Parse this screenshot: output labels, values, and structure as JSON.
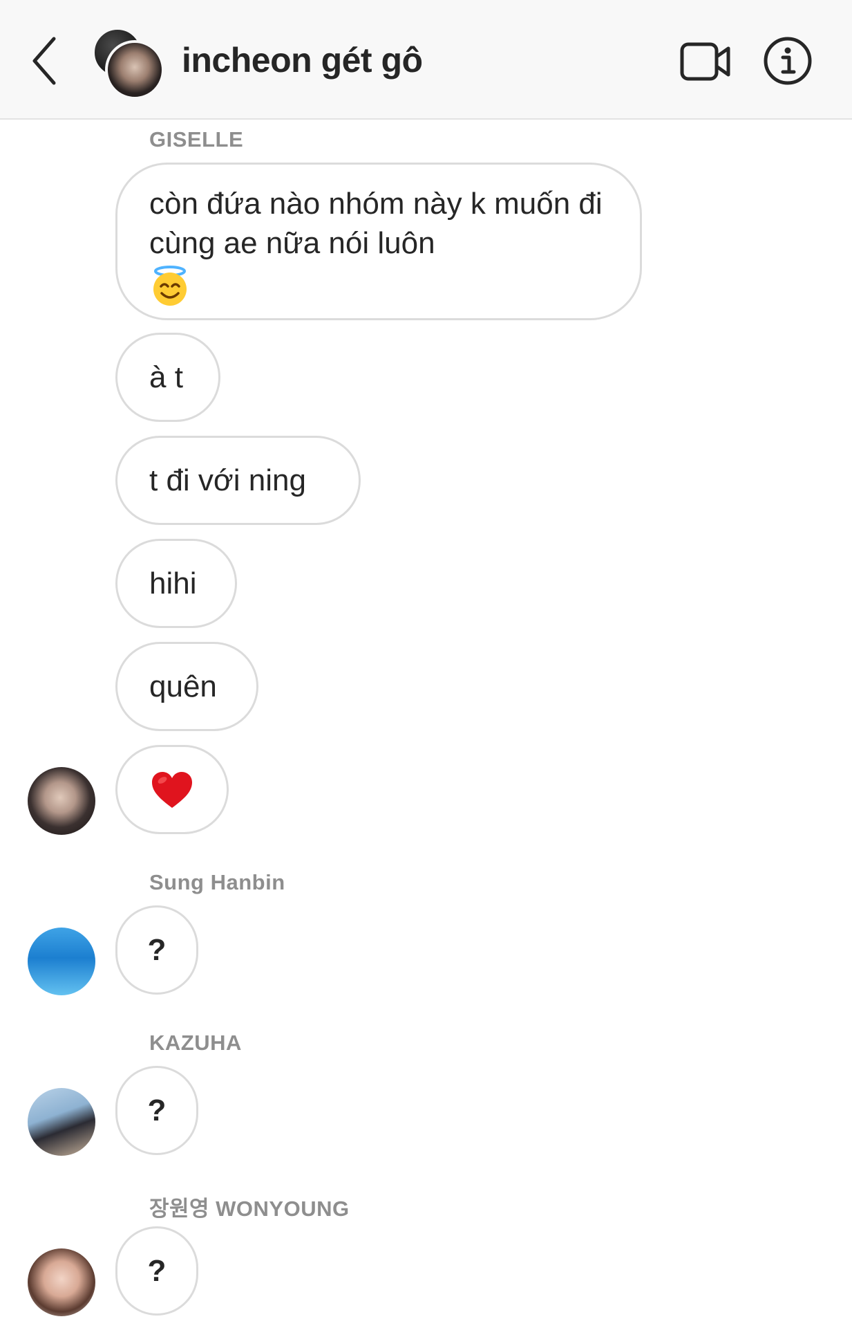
{
  "header": {
    "title": "incheon gét gô",
    "back_icon": "chevron-left-icon",
    "video_icon": "video-camera-icon",
    "info_icon": "info-icon"
  },
  "messages": {
    "giselle": {
      "sender": "GISELLE",
      "bubbles": [
        "còn đứa nào nhóm này k muốn đi cùng ae nữa nói luôn",
        "à t",
        "t đi với ning",
        "hihi",
        "quên"
      ],
      "emoji_1": "smiling-face-with-halo-emoji",
      "emoji_2": "red-heart-emoji"
    },
    "hanbin": {
      "sender": "Sung Hanbin",
      "text": "?"
    },
    "kazuha": {
      "sender": "KAZUHA",
      "text": "?"
    },
    "wonyoung": {
      "sender": "장원영 WONYOUNG",
      "text": "?"
    }
  },
  "colors": {
    "header_bg": "#f8f8f8",
    "bubble_border": "#dbdbdb",
    "text": "#262626",
    "sender_name": "#8e8e8e",
    "heart": "#e0141e"
  }
}
